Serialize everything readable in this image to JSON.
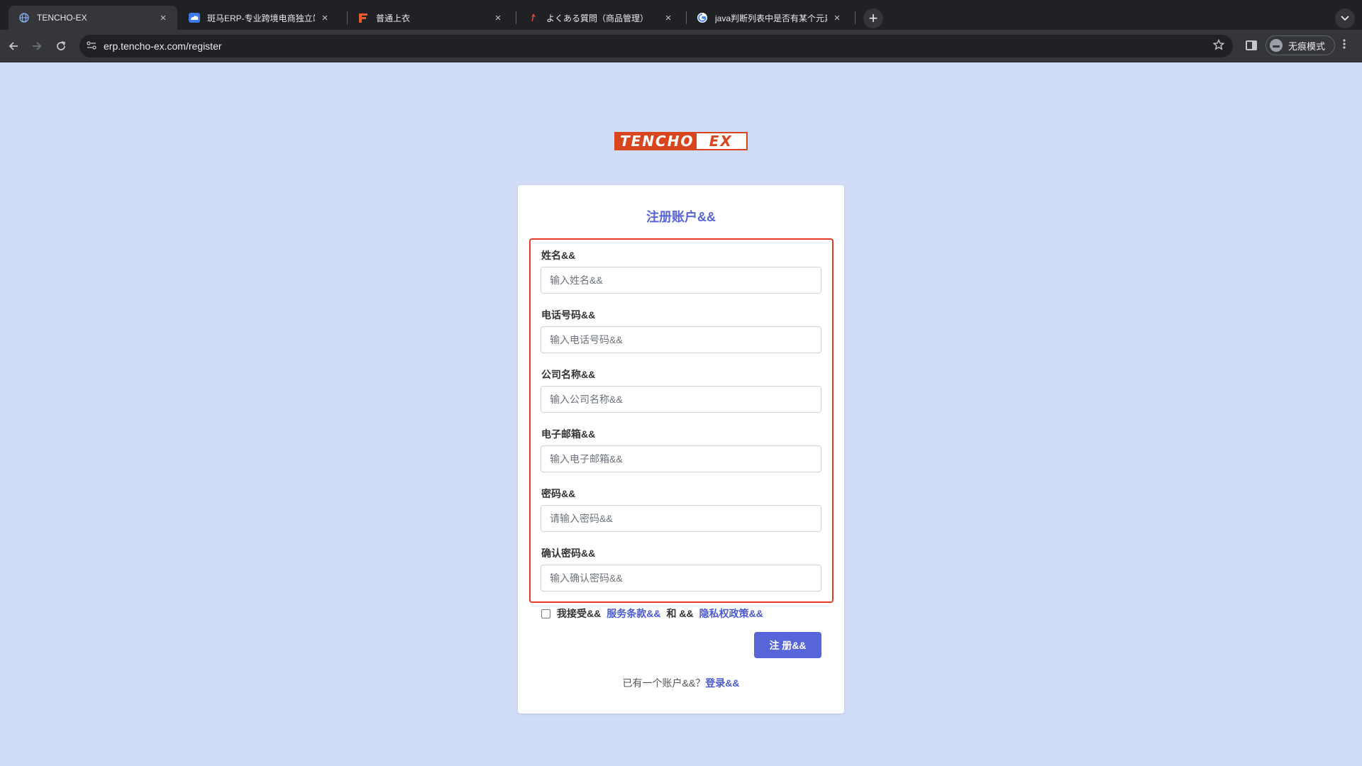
{
  "browser": {
    "tabs": [
      {
        "title": "TENCHO-EX",
        "active": true,
        "icon": "globe-icon"
      },
      {
        "title": "斑马ERP-专业跨境电商独立站E",
        "active": false,
        "icon": "cloud-icon"
      },
      {
        "title": "普通上衣",
        "active": false,
        "icon": "brand-icon"
      },
      {
        "title": "よくある質問（商品管理）",
        "active": false,
        "icon": "pin-icon"
      },
      {
        "title": "java判断列表中是否有某个元素",
        "active": false,
        "icon": "google-icon"
      }
    ],
    "close_glyph": "×",
    "new_tab_glyph": "+",
    "url": "erp.tencho-ex.com/register",
    "incognito_label": "无痕模式"
  },
  "logo": {
    "left": "TENCHO",
    "right": "EX",
    "color": "#d9461e"
  },
  "form": {
    "title": "注册账户&&",
    "fields": [
      {
        "label": "姓名&&",
        "placeholder": "输入姓名&&"
      },
      {
        "label": "电话号码&&",
        "placeholder": "输入电话号码&&"
      },
      {
        "label": "公司名称&&",
        "placeholder": "输入公司名称&&"
      },
      {
        "label": "电子邮箱&&",
        "placeholder": "输入电子邮箱&&"
      },
      {
        "label": "密码&&",
        "placeholder": "请输入密码&&"
      },
      {
        "label": "确认密码&&",
        "placeholder": "输入确认密码&&"
      }
    ],
    "agree": {
      "prefix": "我接受&&",
      "terms_link": "服务条款&&",
      "and": "和 &&",
      "privacy_link": "隐私权政策&&"
    },
    "submit_label": "注 册&&",
    "login_prompt": "已有一个账户&&？",
    "login_link": "登录&&"
  },
  "colors": {
    "accent": "#5865d8",
    "highlight": "#e43a2a",
    "page_bg": "#d1ddf6"
  }
}
